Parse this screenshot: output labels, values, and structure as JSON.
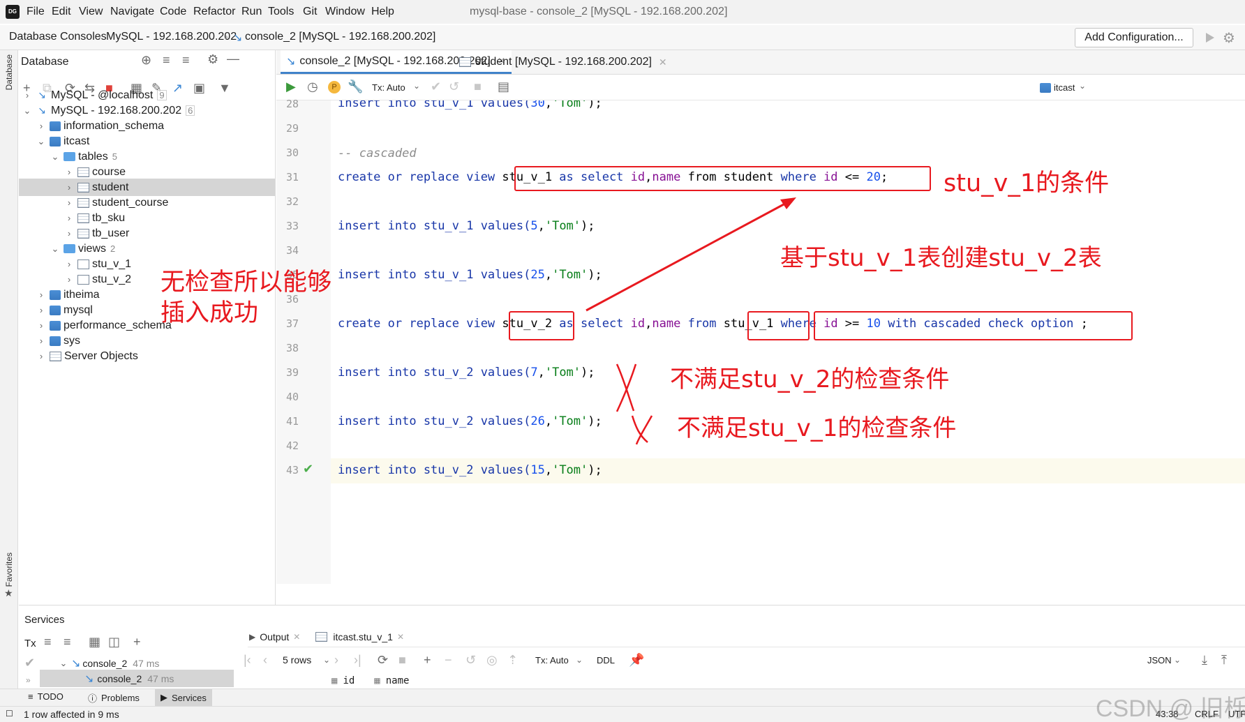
{
  "menubar": {
    "items": [
      "File",
      "Edit",
      "View",
      "Navigate",
      "Code",
      "Refactor",
      "Run",
      "Tools",
      "Git",
      "Window",
      "Help"
    ],
    "title": "mysql-base - console_2 [MySQL - 192.168.200.202]"
  },
  "navbar": {
    "crumbs": [
      "Database Consoles",
      "MySQL - 192.168.200.202",
      "console_2 [MySQL - 192.168.200.202]"
    ],
    "add_config": "Add Configuration..."
  },
  "leftstrip": {
    "database": "Database",
    "favorites": "Favorites"
  },
  "dbpanel": {
    "title": "Database",
    "tree": [
      {
        "label": "MySQL - @localhost",
        "count": "9"
      },
      {
        "label": "MySQL - 192.168.200.202",
        "count": "6"
      },
      {
        "label": "information_schema"
      },
      {
        "label": "itcast"
      },
      {
        "label": "tables",
        "count": "5"
      },
      {
        "label": "course"
      },
      {
        "label": "student"
      },
      {
        "label": "student_course"
      },
      {
        "label": "tb_sku"
      },
      {
        "label": "tb_user"
      },
      {
        "label": "views",
        "count": "2"
      },
      {
        "label": "stu_v_1"
      },
      {
        "label": "stu_v_2"
      },
      {
        "label": "itheima"
      },
      {
        "label": "mysql"
      },
      {
        "label": "performance_schema"
      },
      {
        "label": "sys"
      },
      {
        "label": "Server Objects"
      }
    ]
  },
  "editor": {
    "tabs": [
      "console_2 [MySQL - 192.168.200.202]",
      "student [MySQL - 192.168.200.202]"
    ],
    "tx_mode": "Tx: Auto",
    "schema": "itcast",
    "line_numbers": [
      "28",
      "29",
      "30",
      "31",
      "32",
      "33",
      "34",
      "35",
      "36",
      "37",
      "38",
      "39",
      "40",
      "41",
      "42",
      "43"
    ],
    "lines": {
      "l28": [
        "insert into stu_v_1 values(",
        "30",
        ",",
        "'Tom'",
        ");"
      ],
      "l30": "-- cascaded",
      "l31": [
        "create or replace view ",
        "stu_v_1",
        " as select ",
        "id",
        ",",
        "name",
        " from student ",
        "where ",
        "id",
        " <= ",
        "20",
        ";"
      ],
      "l33": [
        "insert into stu_v_1 values(",
        "5",
        ",",
        "'Tom'",
        ");"
      ],
      "l35": [
        "insert into stu_v_1 values(",
        "25",
        ",",
        "'Tom'",
        ");"
      ],
      "l37": [
        "create or replace view ",
        "stu_v_2",
        " as select ",
        "id",
        ",",
        "name",
        " from ",
        "stu_v_1",
        " where ",
        "id",
        " >= ",
        "10",
        " with cascaded check option",
        " ;"
      ],
      "l39": [
        "insert into stu_v_2 values(",
        "7",
        ",",
        "'Tom'",
        ");"
      ],
      "l41": [
        "insert into stu_v_2 values(",
        "26",
        ",",
        "'Tom'",
        ");"
      ],
      "l43": [
        "insert into stu_v_2 values(",
        "15",
        ",",
        "'Tom'",
        ");"
      ]
    }
  },
  "annotations": {
    "cond_v1": "stu_v_1的条件",
    "based_on": "基于stu_v_1表创建stu_v_2表",
    "no_check_1": "无检查所以能够",
    "no_check_2": "插入成功",
    "fail_v2": "不满足stu_v_2的检查条件",
    "fail_v1": "不满足stu_v_1的检查条件"
  },
  "services": {
    "title": "Services",
    "tx": "Tx",
    "tree": [
      {
        "label": "console_2",
        "time": "47 ms"
      },
      {
        "label": "console_2",
        "time": "47 ms"
      }
    ],
    "tabs": [
      "Output",
      "itcast.stu_v_1"
    ],
    "rows": "5 rows",
    "tx_mode": "Tx: Auto",
    "ddl": "DDL",
    "format": "JSON",
    "columns": [
      "id",
      "name"
    ]
  },
  "bottombar": {
    "tabs": [
      "TODO",
      "Problems",
      "Services"
    ]
  },
  "status": {
    "message": "1 row affected in 9 ms",
    "position": "43:38",
    "line_sep": "CRLF",
    "encoding": "UTF",
    "watermark": "CSDN @ 旧栎"
  },
  "colors": {
    "annotation": "#e8191f",
    "keyword": "#1836a8",
    "string": "#067d17",
    "number": "#1750eb"
  }
}
